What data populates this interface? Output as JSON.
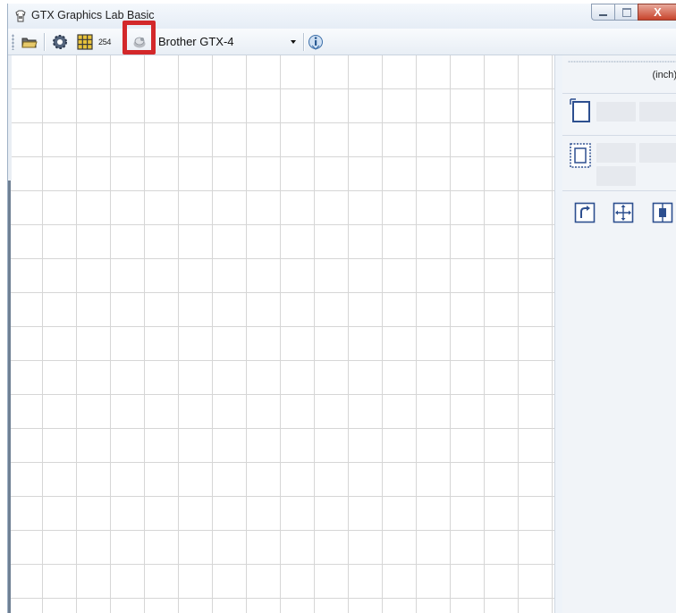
{
  "window": {
    "title": "GTX Graphics Lab Basic",
    "close_glyph": "X"
  },
  "toolbar": {
    "items": [
      {
        "name": "open-folder-icon"
      },
      {
        "name": "settings-gear-icon"
      },
      {
        "name": "grid-icon"
      },
      {
        "name": "printer-properties-icon"
      },
      {
        "name": "info-icon"
      }
    ],
    "grid_size": "254",
    "printer": "Brother GTX-4"
  },
  "panel": {
    "unit": "(inch)"
  },
  "colors": {
    "highlight": "#d3282a",
    "icon_blue": "#2d4f8f"
  }
}
